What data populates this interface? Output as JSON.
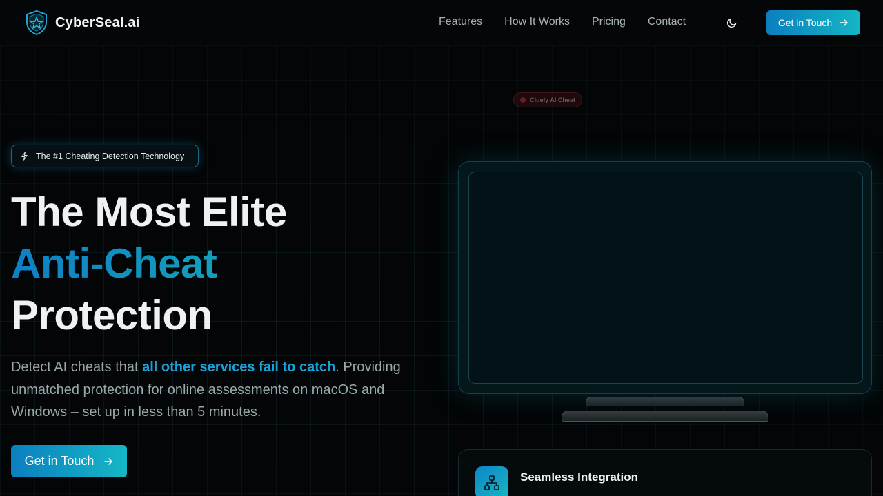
{
  "brand": {
    "name": "CyberSeal.ai",
    "logo_icon": "shield-star-icon"
  },
  "nav": {
    "links": [
      "Features",
      "How It Works",
      "Pricing",
      "Contact"
    ],
    "theme_icon": "moon-icon",
    "cta_label": "Get in Touch"
  },
  "floating_tag": {
    "label": "Cluely AI Cheat"
  },
  "hero": {
    "badge": "The #1 Cheating Detection Technology",
    "headline_line1": "The Most Elite",
    "headline_line2": "Anti-Cheat",
    "headline_line3": "Protection",
    "desc_pre": "Detect AI cheats that ",
    "desc_highlight": "all other services fail to catch",
    "desc_post": ". Providing unmatched protection for online assessments on macOS and Windows – set up in less than 5 minutes.",
    "cta_label": "Get in Touch"
  },
  "feature_card": {
    "icon": "network-icon",
    "title": "Seamless Integration"
  },
  "colors": {
    "accent_start": "#0b7fbf",
    "accent_end": "#14b6c4",
    "background": "#030506"
  }
}
